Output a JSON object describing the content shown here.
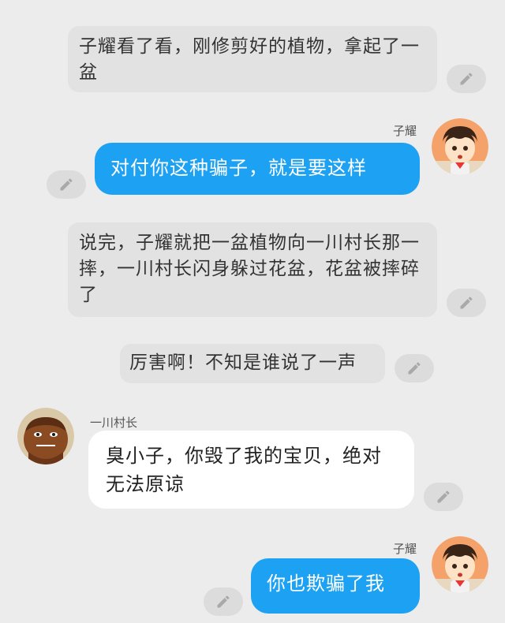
{
  "messages": [
    {
      "kind": "narration",
      "text": "子耀看了看，刚修剪好的植物，拿起了一盆"
    },
    {
      "kind": "speech",
      "speaker": "子耀",
      "side": "right",
      "text": "对付你这种骗子，就是要这样"
    },
    {
      "kind": "narration",
      "text": "说完，子耀就把一盆植物向一川村长那一摔，一川村长闪身躲过花盆，花盆被摔碎了"
    },
    {
      "kind": "narration",
      "text": "厉害啊！不知是谁说了一声"
    },
    {
      "kind": "speech",
      "speaker": "一川村长",
      "side": "left",
      "text": "臭小子，你毁了我的宝贝，绝对无法原谅"
    },
    {
      "kind": "speech",
      "speaker": "子耀",
      "side": "right",
      "text": "你也欺骗了我"
    }
  ],
  "icons": {
    "edit": "pencil-icon"
  },
  "colors": {
    "background": "#ececec",
    "narration_bubble": "#e2e2e2",
    "right_bubble": "#1da1f2",
    "left_bubble": "#ffffff",
    "edit_button": "#dcdcdc"
  }
}
